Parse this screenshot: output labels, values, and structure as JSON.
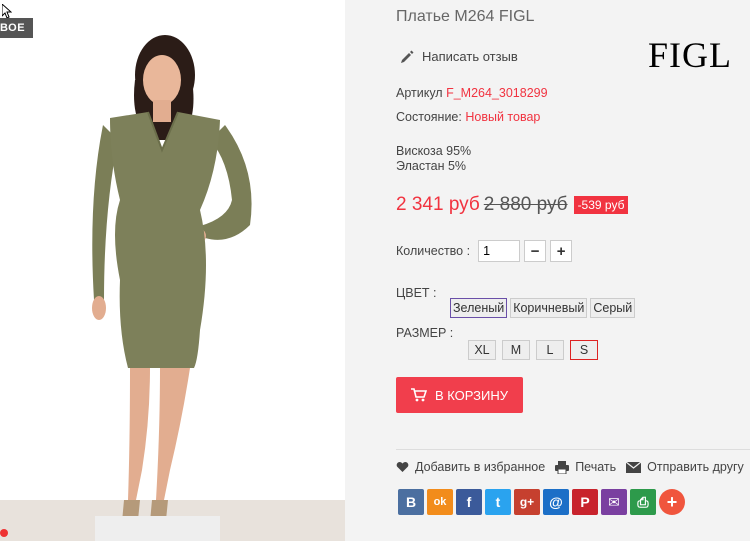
{
  "image": {
    "badge": "ВОЕ"
  },
  "product": {
    "title": "Платье M264 FIGL",
    "brand": "FIGL",
    "review_label": "Написать отзыв",
    "sku_label": "Артикул",
    "sku_value": "F_M264_3018299",
    "condition_label": "Состояние:",
    "condition_value": "Новый товар",
    "composition": [
      "Вискоза 95%",
      "Эластан 5%"
    ],
    "price_new": "2 341 руб",
    "price_old": "2 880 руб",
    "discount": "-539 руб",
    "quantity_label": "Количество :",
    "quantity_value": "1",
    "minus": "−",
    "plus": "+",
    "color_label": "ЦВЕТ :",
    "colors": [
      "Зеленый",
      "Коричневый",
      "Серый"
    ],
    "size_label": "РАЗМЕР :",
    "sizes": [
      "XL",
      "M",
      "L",
      "S"
    ],
    "cart_label": "В КОРЗИНУ"
  },
  "actions": {
    "favorite": "Добавить в избранное",
    "print": "Печать",
    "send": "Отправить другу"
  },
  "social": [
    {
      "icon": "vk-icon",
      "glyph": "B",
      "color": "#4b6fa0"
    },
    {
      "icon": "odnoklassniki-icon",
      "glyph": "ok",
      "color": "#f28c1b"
    },
    {
      "icon": "facebook-icon",
      "glyph": "f",
      "color": "#3b5a9a"
    },
    {
      "icon": "twitter-icon",
      "glyph": "t",
      "color": "#2aa3ef"
    },
    {
      "icon": "google-plus-icon",
      "glyph": "g+",
      "color": "#c6402f"
    },
    {
      "icon": "mailru-icon",
      "glyph": "@",
      "color": "#1c6fc7"
    },
    {
      "icon": "pinterest-icon",
      "glyph": "P",
      "color": "#c8232c"
    },
    {
      "icon": "email-icon",
      "glyph": "✉",
      "color": "#7a3fa0"
    },
    {
      "icon": "print-icon",
      "glyph": "⎙",
      "color": "#2d9a4b"
    },
    {
      "icon": "more-icon",
      "glyph": "+",
      "color": "#f0553d"
    }
  ]
}
